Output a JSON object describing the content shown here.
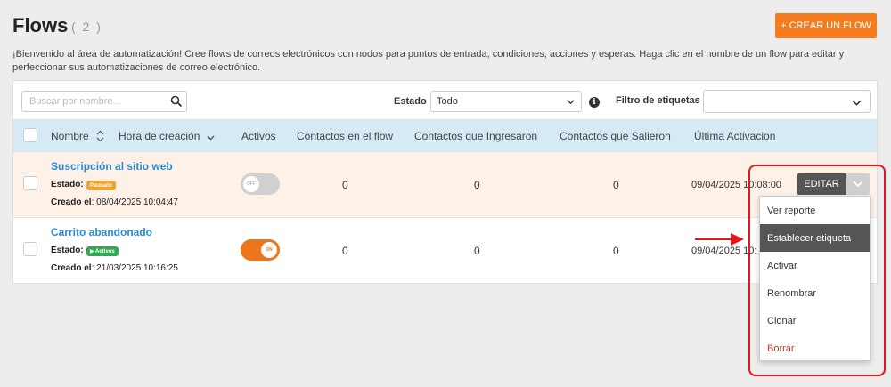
{
  "page": {
    "title": "Flows",
    "count": "( 2 )",
    "create_button": "+ CREAR UN FLOW",
    "intro": "¡Bienvenido al área de automatización! Cree flows de correos electrónicos con nodos para puntos de entrada, condiciones, acciones y esperas. Haga clic en el nombre de un flow para editar y perfeccionar sus automatizaciones de correo electrónico."
  },
  "filters": {
    "search_placeholder": "Buscar por nombre...",
    "estado_label": "Estado",
    "estado_value": "Todo",
    "tags_label": "Filtro de etiquetas",
    "tags_value": ""
  },
  "table": {
    "headers": {
      "name": "Nombre",
      "created": "Hora de creación",
      "active": "Activos",
      "in_flow": "Contactos en el flow",
      "entered": "Contactos que Ingresaron",
      "left": "Contactos que Salieron",
      "last": "Última Activacion"
    },
    "rows": [
      {
        "name": "Suscripción al sitio web",
        "state_label": "Estado:",
        "state": "Pausado",
        "created_label": "Creado el",
        "created": ": 08/04/2025 10:04:47",
        "toggle": "OFF",
        "in_flow": "0",
        "entered": "0",
        "left": "0",
        "last": "09/04/2025 10:08:00"
      },
      {
        "name": "Carrito abandonado",
        "state_label": "Estado:",
        "state": "▶ Activos",
        "created_label": "Creado el",
        "created": ": 21/03/2025 10:16:25",
        "toggle": "ON",
        "in_flow": "0",
        "entered": "0",
        "left": "0",
        "last": "09/04/2025 10:"
      }
    ]
  },
  "actions": {
    "edit_label": "EDITAR",
    "menu": [
      "Ver reporte",
      "Establecer etiqueta",
      "Activar",
      "Renombrar",
      "Clonar",
      "Borrar"
    ]
  },
  "colors": {
    "accent": "#f57c1f",
    "link": "#2a8bd4",
    "header_bg": "#d6eaf5",
    "annotation": "#e3161b"
  }
}
